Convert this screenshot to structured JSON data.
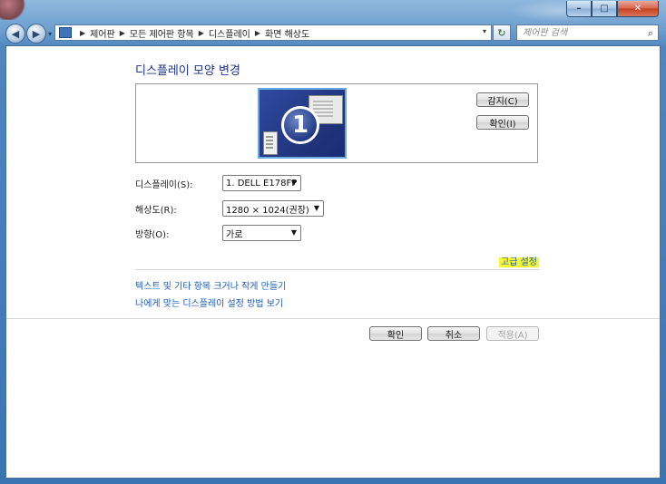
{
  "window": {
    "caption": {
      "minimize": "–",
      "maximize": "□",
      "close": "✕"
    }
  },
  "nav": {
    "back": "◀",
    "forward": "▶",
    "dropdown": "▾"
  },
  "address": {
    "breadcrumbs": [
      "제어판",
      "모든 제어판 항목",
      "디스플레이",
      "화면 해상도"
    ],
    "dropdown": "▾"
  },
  "search": {
    "placeholder": "제어판 검색",
    "icon": "⌕"
  },
  "refresh": "↻",
  "page": {
    "title": "디스플레이 모양 변경",
    "monitor_number": "1",
    "detect_button": "감지(C)",
    "identify_button": "확인(I)"
  },
  "settings": {
    "display": {
      "label": "디스플레이(S):",
      "value": "1. DELL E178FP"
    },
    "resolution": {
      "label": "해상도(R):",
      "value": "1280 × 1024(권장)"
    },
    "orientation": {
      "label": "방향(O):",
      "value": "가로"
    }
  },
  "links": {
    "advanced": "고급 설정",
    "text_size": "텍스트 및 기타 항목 크거나 작게 만들기",
    "help": "나에게 맞는 디스플레이 설정 방법 보기"
  },
  "footer": {
    "ok": "확인",
    "cancel": "취소",
    "apply": "적용(A)"
  },
  "colors": {
    "link": "#1a5dbf",
    "title": "#1e3287",
    "highlight": "#f7f733"
  }
}
